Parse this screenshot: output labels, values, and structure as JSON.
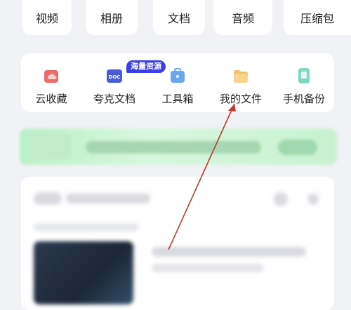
{
  "categories": [
    {
      "label": "视频"
    },
    {
      "label": "相册"
    },
    {
      "label": "文档"
    },
    {
      "label": "音频"
    },
    {
      "label": "压缩包"
    }
  ],
  "tools": [
    {
      "label": "云收藏",
      "icon": "cloud-collect-icon",
      "color": "#ef6b6b"
    },
    {
      "label": "夸克文档",
      "icon": "doc-icon",
      "color": "#4b5bd8",
      "icon_text": "DOC"
    },
    {
      "label": "工具箱",
      "icon": "toolbox-icon",
      "color": "#6aa6ee"
    },
    {
      "label": "我的文件",
      "icon": "folder-icon",
      "color": "#f2c26a"
    },
    {
      "label": "手机备份",
      "icon": "phone-backup-icon",
      "color": "#7fd8c2"
    }
  ],
  "badge": {
    "label": "海量资源"
  },
  "colors": {
    "background": "#f1f2f5",
    "card": "#ffffff",
    "badge": "#3b3fe6",
    "arrow": "#c0392b",
    "banner": "#c7f2d1"
  }
}
